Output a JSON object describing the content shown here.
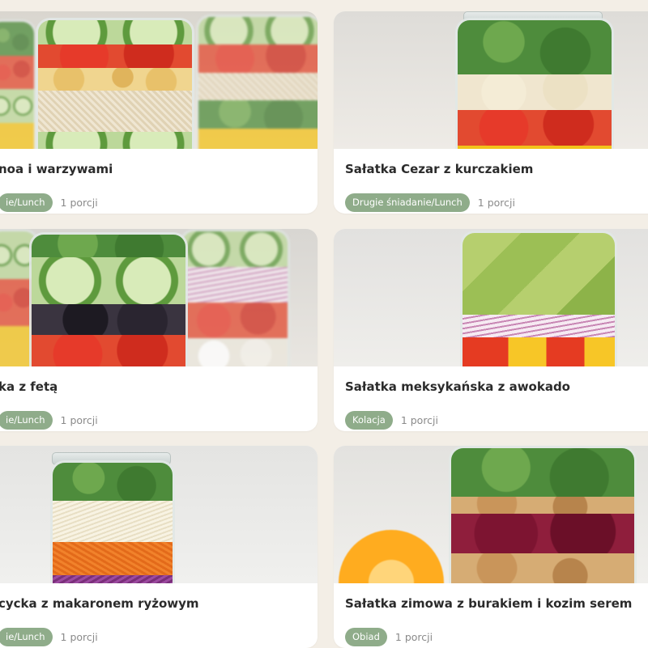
{
  "cards": [
    {
      "title": "noa i warzywami",
      "badge": "ie/Lunch",
      "portions": "1 porcji"
    },
    {
      "title": "Sałatka Cezar z kurczakiem",
      "badge": "Drugie śniadanie/Lunch",
      "portions": "1 porcji"
    },
    {
      "title": "ka z fetą",
      "badge": "ie/Lunch",
      "portions": "1 porcji"
    },
    {
      "title": "Sałatka meksykańska z awokado",
      "badge": "Kolacja",
      "portions": "1 porcji"
    },
    {
      "title": "cycka z makaronem ryżowym",
      "badge": "ie/Lunch",
      "portions": "1 porcji"
    },
    {
      "title": "Sałatka zimowa z burakiem i kozim serem",
      "badge": "Obiad",
      "portions": "1 porcji"
    }
  ],
  "colors": {
    "page_bg": "#f3eee6",
    "card_bg": "#ffffff",
    "badge_bg": "#8fac8a",
    "title": "#2b2b2b",
    "muted": "#8a8a8a"
  }
}
